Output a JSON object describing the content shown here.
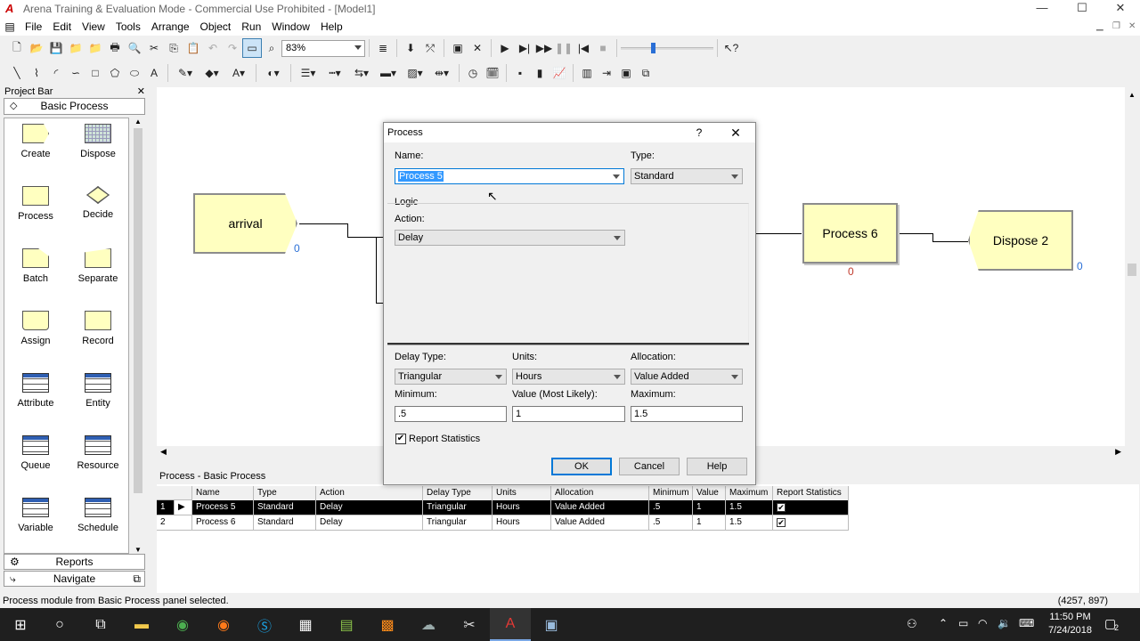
{
  "window": {
    "title": "Arena Training & Evaluation Mode - Commercial Use Prohibited - [Model1]",
    "minimize": "—",
    "maximize": "☐",
    "close": "✕",
    "app_icon": "A"
  },
  "menu": {
    "items": [
      "File",
      "Edit",
      "View",
      "Tools",
      "Arrange",
      "Object",
      "Run",
      "Window",
      "Help"
    ]
  },
  "toolbar": {
    "zoom": "83%"
  },
  "project_bar": {
    "title": "Project Bar",
    "close": "✕",
    "panel": "Basic Process",
    "modules": [
      {
        "label": "Create"
      },
      {
        "label": "Dispose"
      },
      {
        "label": "Process"
      },
      {
        "label": "Decide"
      },
      {
        "label": "Batch"
      },
      {
        "label": "Separate"
      },
      {
        "label": "Assign"
      },
      {
        "label": "Record"
      },
      {
        "label": "Attribute"
      },
      {
        "label": "Entity"
      },
      {
        "label": "Queue"
      },
      {
        "label": "Resource"
      },
      {
        "label": "Variable"
      },
      {
        "label": "Schedule"
      }
    ],
    "footer": [
      "Reports",
      "Navigate"
    ]
  },
  "canvas": {
    "modules": [
      {
        "label": "arrival",
        "count": "0"
      },
      {
        "label": "Process 6",
        "count": "0"
      },
      {
        "label": "Dispose 2",
        "count": "0"
      }
    ]
  },
  "sheet": {
    "title": "Process - Basic Process",
    "columns": [
      "Name",
      "Type",
      "Action",
      "Delay Type",
      "Units",
      "Allocation",
      "Minimum",
      "Value",
      "Maximum",
      "Report Statistics"
    ],
    "rows": [
      {
        "num": "1",
        "marker": "▶",
        "name": "Process 5",
        "type": "Standard",
        "action": "Delay",
        "delay_type": "Triangular",
        "units": "Hours",
        "allocation": "Value Added",
        "minimum": ".5",
        "value": "1",
        "maximum": "1.5",
        "report": "✔"
      },
      {
        "num": "2",
        "marker": "",
        "name": "Process 6",
        "type": "Standard",
        "action": "Delay",
        "delay_type": "Triangular",
        "units": "Hours",
        "allocation": "Value Added",
        "minimum": ".5",
        "value": "1",
        "maximum": "1.5",
        "report": "✔"
      }
    ]
  },
  "status": {
    "message": "Process module from Basic Process panel selected.",
    "coords": "(4257, 897)"
  },
  "dialog": {
    "title": "Process",
    "help": "?",
    "close": "✕",
    "name_label": "Name:",
    "name_value": "Process 5",
    "type_label": "Type:",
    "type_value": "Standard",
    "logic_label": "Logic",
    "action_label": "Action:",
    "action_value": "Delay",
    "delay_type_label": "Delay Type:",
    "delay_type_value": "Triangular",
    "units_label": "Units:",
    "units_value": "Hours",
    "allocation_label": "Allocation:",
    "allocation_value": "Value Added",
    "minimum_label": "Minimum:",
    "minimum_value": ".5",
    "most_likely_label": "Value (Most Likely):",
    "most_likely_value": "1",
    "maximum_label": "Maximum:",
    "maximum_value": "1.5",
    "report_label": "Report Statistics",
    "report_checked": "✔",
    "ok": "OK",
    "cancel": "Cancel",
    "help_button": "Help"
  },
  "taskbar": {
    "time": "11:50 PM",
    "date": "7/24/2018",
    "notifications": "2"
  }
}
